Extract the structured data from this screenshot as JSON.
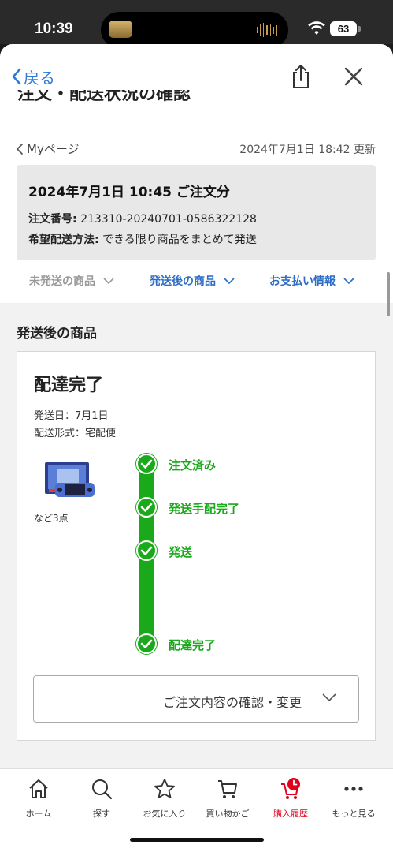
{
  "status_bar": {
    "time": "10:39",
    "battery": "63"
  },
  "header": {
    "back_label": "戻る",
    "page_title": "注文・配送状況の確認"
  },
  "breadcrumb": {
    "label": "Myページ",
    "updated": "2024年7月1日 18:42 更新"
  },
  "order": {
    "date_title": "2024年7月1日 10:45 ご注文分",
    "number_label": "注文番号:",
    "number_value": "213310-20240701-0586322128",
    "method_label": "希望配送方法:",
    "method_value": "できる限り商品をまとめて発送"
  },
  "tabs": [
    {
      "label": "未発送の商品",
      "state": "muted"
    },
    {
      "label": "発送後の商品",
      "state": "active"
    },
    {
      "label": "お支払い情報",
      "state": "active"
    }
  ],
  "section_title": "発送後の商品",
  "shipment": {
    "status": "配達完了",
    "ship_date": "発送日：7月1日",
    "ship_method": "配送形式：宅配便",
    "product_more": "など3点",
    "steps": [
      "注文済み",
      "発送手配完了",
      "発送",
      "配達完了"
    ],
    "confirm_button": "ご注文内容の確認・変更"
  },
  "tabbar": {
    "items": [
      {
        "label": "ホーム",
        "icon": "home-icon"
      },
      {
        "label": "探す",
        "icon": "search-icon"
      },
      {
        "label": "お気に入り",
        "icon": "star-icon"
      },
      {
        "label": "買い物かご",
        "icon": "cart-icon"
      },
      {
        "label": "購入履歴",
        "icon": "history-cart-icon",
        "active": true
      },
      {
        "label": "もっと見る",
        "icon": "more-icon"
      }
    ]
  },
  "colors": {
    "accent_blue": "#2f7ad6",
    "tab_blue": "#2b6cc4",
    "success_green": "#1aa91a",
    "active_red": "#e0001a"
  }
}
